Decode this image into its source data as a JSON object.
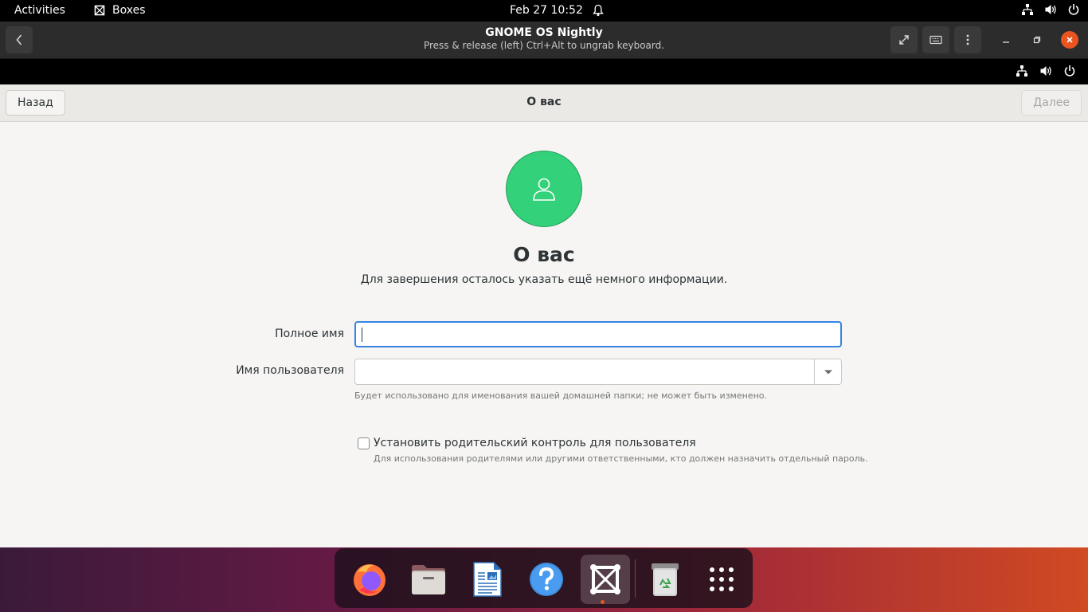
{
  "topbar": {
    "activities": "Activities",
    "app_name": "Boxes",
    "clock": "Feb 27  10:52"
  },
  "boxes_window": {
    "title": "GNOME OS Nightly",
    "subtitle": "Press & release (left) Ctrl+Alt to ungrab keyboard."
  },
  "guest": {
    "header": {
      "back_label": "Назад",
      "title": "О вас",
      "next_label": "Далее"
    },
    "page": {
      "heading": "О вас",
      "subtitle": "Для завершения осталось указать ещё немного информации.",
      "fullname_label": "Полное имя",
      "fullname_value": "",
      "username_label": "Имя пользователя",
      "username_value": "",
      "username_hint": "Будет использовано для именования вашей домашней папки; не может быть изменено.",
      "parental_label": "Установить родительский контроль для пользователя",
      "parental_hint": "Для использования родителями или другими ответственными, кто должен назначить отдельный пароль.",
      "parental_checked": false
    }
  },
  "dock": {
    "items": [
      "firefox-icon",
      "files-icon",
      "libreoffice-writer-icon",
      "help-icon",
      "boxes-icon",
      "trash-icon",
      "show-apps-icon"
    ],
    "active": "boxes-icon"
  },
  "colors": {
    "accent_orange": "#e95420",
    "avatar_green": "#33d17a",
    "focus_blue": "#3584e4"
  }
}
